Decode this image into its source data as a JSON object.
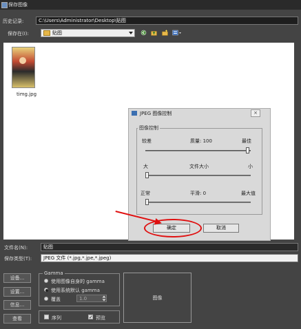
{
  "window": {
    "title": "保存图像"
  },
  "history": {
    "label": "历史记录:",
    "path": "C:\\Users\\Administrator\\Desktop\\贴图"
  },
  "save_in": {
    "label": "保存在(I):",
    "folder": "贴图"
  },
  "files": [
    {
      "name": "timg.jpg"
    }
  ],
  "jpeg_dialog": {
    "title": "JPEG 图像控制",
    "close_symbol": "×",
    "group_label": "图像控制",
    "quality": {
      "left": "较差",
      "center": "质量: 100",
      "right": "最佳",
      "value": 100
    },
    "filesize": {
      "left": "大",
      "center": "文件大小",
      "right": "小",
      "value": 0
    },
    "smoothing": {
      "left": "正常",
      "center": "平滑: 0",
      "right": "最大值",
      "value": 0
    },
    "ok_label": "确定",
    "cancel_label": "取消"
  },
  "filename": {
    "label": "文件名(N):",
    "value": "贴图"
  },
  "filetype": {
    "label": "保存类型(T):",
    "value": "JPEG 文件 (*.jpg,*.jpe,*.jpeg)"
  },
  "side_buttons": [
    "设备...",
    "设置...",
    "信息...",
    "查看"
  ],
  "gamma": {
    "label": "Gamma",
    "options": [
      "使用图像自身的 gamma",
      "使用系统默认 gamma",
      "覆盖"
    ],
    "selected": 1,
    "override_value": "1.0"
  },
  "sequence": {
    "label": "序列",
    "checked": false
  },
  "preview_checkbox": {
    "label": "预览",
    "checked": true
  },
  "preview_box": {
    "label": "图像"
  }
}
